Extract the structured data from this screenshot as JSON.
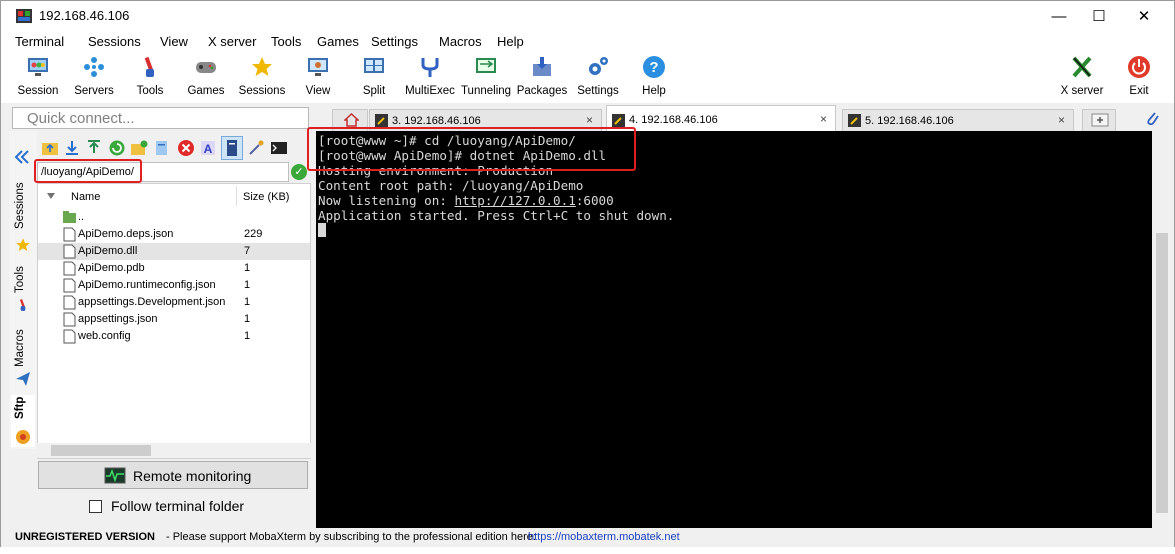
{
  "window": {
    "title": "192.168.46.106",
    "minimize": "—",
    "maximize": "☐",
    "close": "✕"
  },
  "menu": [
    "Terminal",
    "Sessions",
    "View",
    "X server",
    "Tools",
    "Games",
    "Settings",
    "Macros",
    "Help"
  ],
  "toolbar": {
    "session": "Session",
    "servers": "Servers",
    "tools": "Tools",
    "games": "Games",
    "sessions": "Sessions",
    "view": "View",
    "split": "Split",
    "multiexec": "MultiExec",
    "tunneling": "Tunneling",
    "packages": "Packages",
    "settings": "Settings",
    "help": "Help",
    "xserver": "X server",
    "exit": "Exit"
  },
  "quick_connect": {
    "placeholder": "Quick connect..."
  },
  "tabs": [
    {
      "label": "3. 192.168.46.106"
    },
    {
      "label": "4. 192.168.46.106"
    },
    {
      "label": "5. 192.168.46.106"
    }
  ],
  "tab_close": "×",
  "sidebar": {
    "sessions": "Sessions",
    "tools": "Tools",
    "macros": "Macros",
    "sftp": "Sftp"
  },
  "sftp": {
    "path": "/luoyang/ApiDemo/",
    "ok_mark": "✓",
    "col_name": "Name",
    "col_size": "Size (KB)",
    "files": [
      {
        "name": "..",
        "size": ""
      },
      {
        "name": "ApiDemo.deps.json",
        "size": "229"
      },
      {
        "name": "ApiDemo.dll",
        "size": "7"
      },
      {
        "name": "ApiDemo.pdb",
        "size": "1"
      },
      {
        "name": "ApiDemo.runtimeconfig.json",
        "size": "1"
      },
      {
        "name": "appsettings.Development.json",
        "size": "1"
      },
      {
        "name": "appsettings.json",
        "size": "1"
      },
      {
        "name": "web.config",
        "size": "1"
      }
    ],
    "remote_monitoring": "Remote monitoring",
    "follow_terminal": "Follow terminal folder"
  },
  "terminal": {
    "lines": [
      "[root@www ~]# cd /luoyang/ApiDemo/",
      "[root@www ApiDemo]# dotnet ApiDemo.dll",
      "Hosting environment: Production",
      "Content root path: /luoyang/ApiDemo"
    ],
    "listen_prefix": "Now listening on: ",
    "listen_link": "http://127.0.0.1",
    "listen_suffix": ":6000",
    "started": "Application started. Press Ctrl+C to shut down."
  },
  "status": {
    "unregistered": "UNREGISTERED VERSION",
    "message": "-  Please support MobaXterm by subscribing to the professional edition here:",
    "link": "https://mobaxterm.mobatek.net"
  },
  "colors": {
    "highlight_red": "#e02020",
    "terminal_bg": "#000000",
    "link_blue": "#1a3fbf"
  }
}
